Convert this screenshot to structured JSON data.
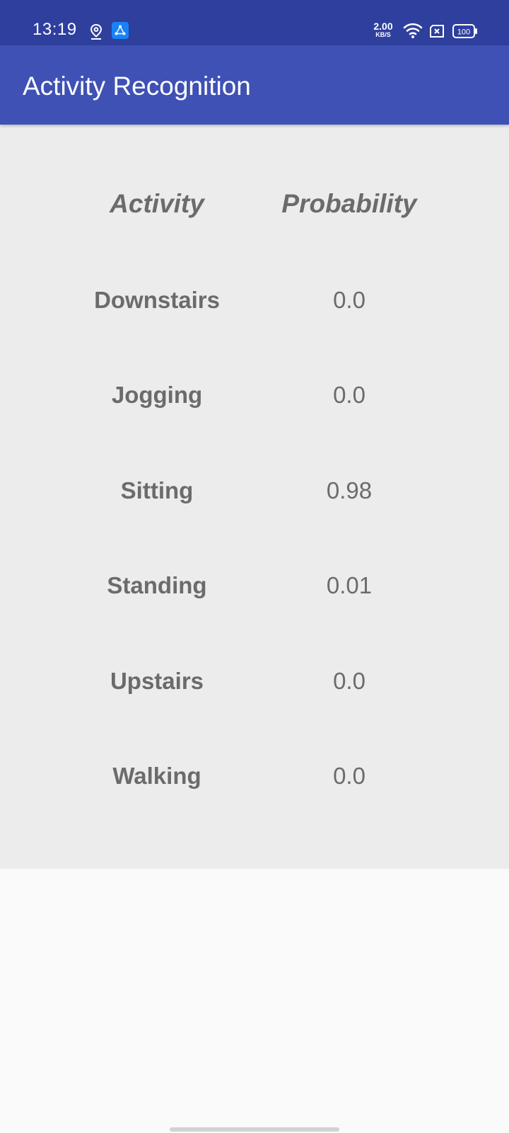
{
  "status_bar": {
    "time": "13:19",
    "net_speed_value": "2.00",
    "net_speed_unit": "KB/S",
    "battery": "100",
    "icons": [
      "location-icon",
      "app-notification-icon",
      "wifi-icon",
      "sim-icon",
      "battery-icon"
    ]
  },
  "app_bar": {
    "title": "Activity Recognition"
  },
  "table": {
    "headers": {
      "activity": "Activity",
      "probability": "Probability"
    },
    "rows": [
      {
        "activity": "Downstairs",
        "probability": "0.0"
      },
      {
        "activity": "Jogging",
        "probability": "0.0"
      },
      {
        "activity": "Sitting",
        "probability": "0.98"
      },
      {
        "activity": "Standing",
        "probability": "0.01"
      },
      {
        "activity": "Upstairs",
        "probability": "0.0"
      },
      {
        "activity": "Walking",
        "probability": "0.0"
      }
    ]
  },
  "colors": {
    "status_bar": "#2f3f9e",
    "app_bar": "#3f51b5",
    "panel_background": "#ececec",
    "page_background": "#fafafa",
    "text": "#6b6b6b"
  }
}
